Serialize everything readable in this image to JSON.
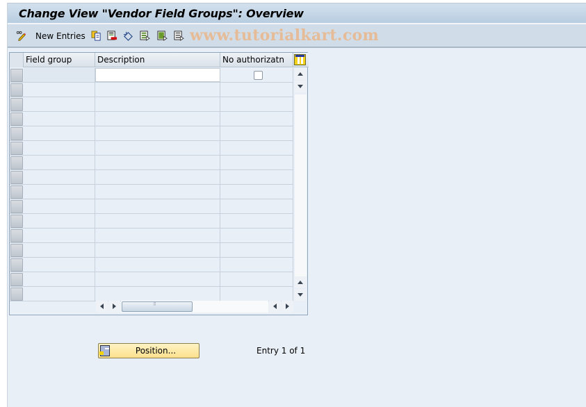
{
  "title": "Change View \"Vendor Field Groups\": Overview",
  "toolbar": {
    "items": [
      {
        "icon": "pencil-glasses-icon",
        "label": ""
      },
      {
        "icon": "new-entries",
        "label": "New Entries"
      },
      {
        "icon": "copy-as-icon",
        "label": ""
      },
      {
        "icon": "delete-icon",
        "label": ""
      },
      {
        "icon": "undo-change-icon",
        "label": ""
      },
      {
        "icon": "select-all-icon",
        "label": ""
      },
      {
        "icon": "select-block-icon",
        "label": ""
      },
      {
        "icon": "deselect-all-icon",
        "label": ""
      }
    ],
    "new_entries_label": "New Entries",
    "watermark": "www.tutorialkart.com"
  },
  "table": {
    "columns": [
      "Field group",
      "Description",
      "No authorizatn"
    ],
    "rows": [
      {
        "field_group": "",
        "description": "",
        "no_authorization": false
      }
    ],
    "empty_row_count": 15
  },
  "footer": {
    "position_button": "Position...",
    "entry_info": "Entry 1 of 1"
  }
}
